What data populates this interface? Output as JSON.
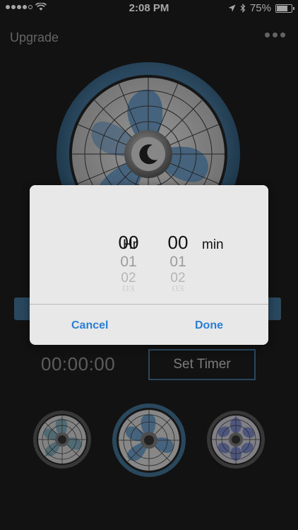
{
  "status_bar": {
    "time": "2:08 PM",
    "battery_text": "75%",
    "battery_level": 0.75,
    "signal_bars": 4,
    "icons": [
      "wifi-icon",
      "location-arrow-icon",
      "bluetooth-icon",
      "battery-icon"
    ]
  },
  "nav": {
    "upgrade_label": "Upgrade",
    "more_icon": "more-dots-icon"
  },
  "main_fan": {
    "icon": "fan-icon",
    "center_icon": "moon-icon",
    "blade_color": "#5b8fbf",
    "ring_color": "#3f6e90"
  },
  "timer": {
    "display": "00:00:00",
    "set_label": "Set Timer"
  },
  "picker": {
    "hours": {
      "selected": "00",
      "next": [
        "01",
        "02",
        "03"
      ],
      "unit": "Hr"
    },
    "minutes": {
      "selected": "00",
      "next": [
        "01",
        "02",
        "03"
      ],
      "unit": "min"
    },
    "cancel_label": "Cancel",
    "done_label": "Done",
    "accent_color": "#2a7fd4"
  },
  "fan_choices": [
    {
      "icon": "fan-teal-icon",
      "blade_color": "#6f9fb0",
      "selected": false
    },
    {
      "icon": "fan-blue-icon",
      "blade_color": "#5b8fbf",
      "selected": true
    },
    {
      "icon": "fan-purple-icon",
      "blade_color": "#6f7fc0",
      "selected": false
    }
  ]
}
